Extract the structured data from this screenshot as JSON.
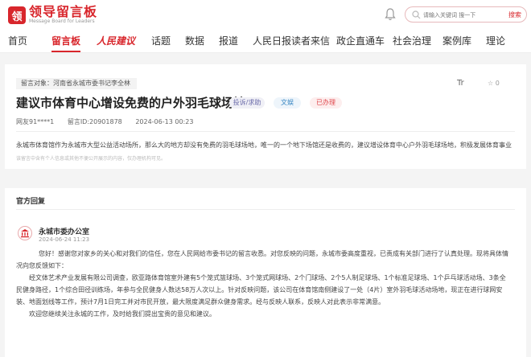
{
  "header": {
    "logo_mark": "领",
    "logo_text": "领导留言板",
    "logo_subtitle": "Message Board for Leaders",
    "search_placeholder": "请输入关键词 搜一下",
    "search_button": "搜索"
  },
  "nav": {
    "items": [
      "首页",
      "留言板",
      "人民建议",
      "话题",
      "数据",
      "报道",
      "人民日报读者来信",
      "政企直通车",
      "社会治理",
      "案例库",
      "理论"
    ],
    "active": "留言板"
  },
  "message": {
    "target": "留言对象：河南省永城市委书记李全林",
    "font_icon": "Tr",
    "favorite": "☆ 0",
    "title": "建议市体育中心增设免费的户外羽毛球场地",
    "tags": {
      "type": "投诉/求助",
      "domain": "文娱",
      "status": "已办理"
    },
    "author": "网友91****1",
    "message_id": "留言ID:20901878",
    "time": "2024-06-13 00:23",
    "body": "永城市体育馆作为永城市大型公益活动场所，那么大的地方却没有免费的羽毛球场地，唯一的一个地下场馆还是收费的，建议增设体育中心户外羽毛球场地，积极发展体育事业",
    "note": "该留言中含有个人信息或其他不便公开展示的内容，仅办理机构可见。"
  },
  "reply": {
    "section_title": "官方回复",
    "org": "永城市委办公室",
    "time": "2024-06-24 11:23",
    "paragraphs": [
      "您好！感谢您对家乡的关心和对我们的信任，您在人民网给市委书记的留言收悉。对您反映的问题，永城市委高度重视，已责成有关部门进行了认真处理。现将具体情",
      "况向您反馈如下：",
      "　　经文体艺术产业发展有限公司调查，欧亚路体育馆室外建有5个笼式篮球场、3个笼式网球场、2个门球场、2个5人制足球场、1个标准足球场、1个乒乓球活动场、3条全",
      "民健身路径，1个综合田径训练场，年参与全民健身人数达58万人次以上。针对反映问题，该公司在体育馆南侧建设了一处（4片）室外羽毛球活动场地，现正在进行球网安",
      "装、地面划线等工作，预计7月1日完工并对市民开放，最大限度满足群众健身需求。经与反映人联系，反映人对此表示非常满意。",
      "　　欢迎您继续关注永城的工作，及时给我们提出宝贵的意见和建议。"
    ]
  },
  "colors": {
    "brand": "#d8262c",
    "page_bg": "#f4f4f4"
  }
}
